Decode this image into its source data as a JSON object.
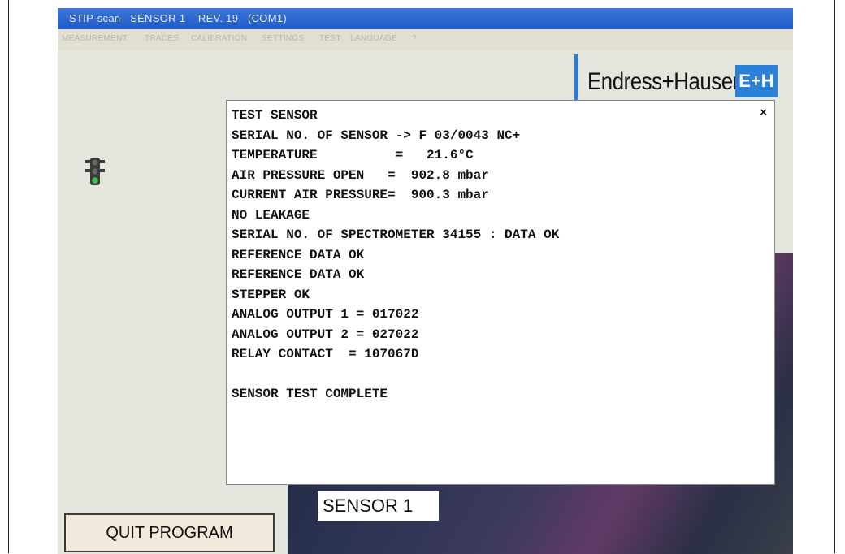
{
  "window": {
    "title": "STIP-scan   SENSOR 1    REV. 19   (COM1)"
  },
  "menu": {
    "items": [
      "MEASUREMENT",
      "TRACES",
      "CALIBRATION",
      "SETTINGS",
      "TEST",
      "LANGUAGE",
      "?"
    ]
  },
  "logo": {
    "text": "Endress+Hauser",
    "mark": "E+H",
    "color": "#2b80d8"
  },
  "dialog": {
    "close_label": "×",
    "lines": [
      "TEST SENSOR",
      "SERIAL NO. OF SENSOR -> F 03/0043 NC+",
      "TEMPERATURE          =   21.6°C",
      "AIR PRESSURE OPEN   =  902.8 mbar",
      "CURRENT AIR PRESSURE=  900.3 mbar",
      "NO LEAKAGE",
      "SERIAL NO. OF SPECTROMETER 34155 : DATA OK",
      "REFERENCE DATA OK",
      "REFERENCE DATA OK",
      "STEPPER OK",
      "ANALOG OUTPUT 1 = 017022",
      "ANALOG OUTPUT 2 = 027022",
      "RELAY CONTACT  = 107067D",
      "",
      "SENSOR TEST COMPLETE"
    ]
  },
  "sensor_label": "SENSOR 1",
  "quit_button": "QUIT PROGRAM",
  "status_light": {
    "icon": "traffic-light-icon",
    "active": "green"
  }
}
